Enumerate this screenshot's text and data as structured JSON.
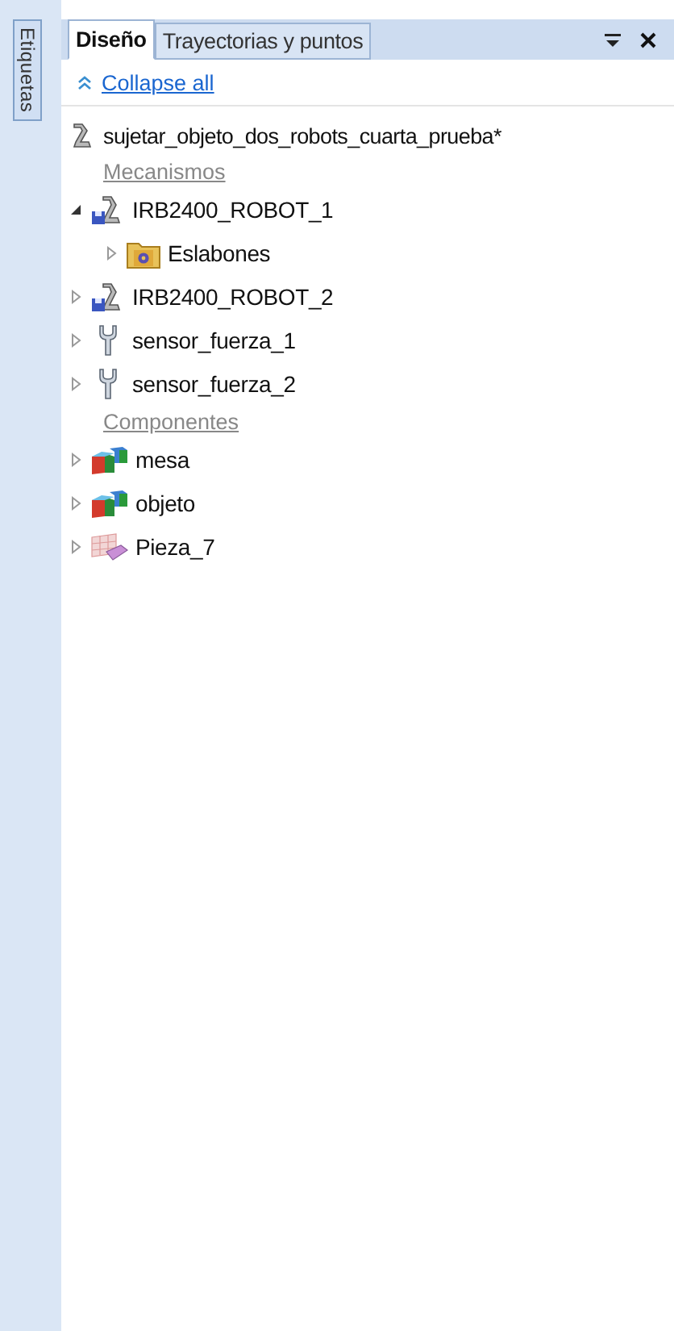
{
  "side_tab": {
    "label": "Etiquetas"
  },
  "tabs": [
    {
      "label": "Diseño",
      "selected": true
    },
    {
      "label": "Trayectorias y puntos",
      "selected": false
    }
  ],
  "collapse_link": "Collapse all",
  "root": {
    "label": "sujetar_objeto_dos_robots_cuarta_prueba*",
    "kind": "robot"
  },
  "rows": [
    {
      "kind": "heading",
      "label": "Mecanismos"
    },
    {
      "kind": "robot",
      "label": "IRB2400_ROBOT_1",
      "expanded": true,
      "children": [
        {
          "kind": "folder",
          "label": "Eslabones",
          "expanded": false
        }
      ]
    },
    {
      "kind": "robot",
      "label": "IRB2400_ROBOT_2",
      "expanded": false
    },
    {
      "kind": "tool",
      "label": "sensor_fuerza_1",
      "expanded": false
    },
    {
      "kind": "tool",
      "label": "sensor_fuerza_2",
      "expanded": false
    },
    {
      "kind": "heading",
      "label": "Componentes"
    },
    {
      "kind": "part",
      "label": "mesa",
      "expanded": false
    },
    {
      "kind": "part",
      "label": "objeto",
      "expanded": false
    },
    {
      "kind": "mesh",
      "label": "Pieza_7",
      "expanded": false
    }
  ]
}
